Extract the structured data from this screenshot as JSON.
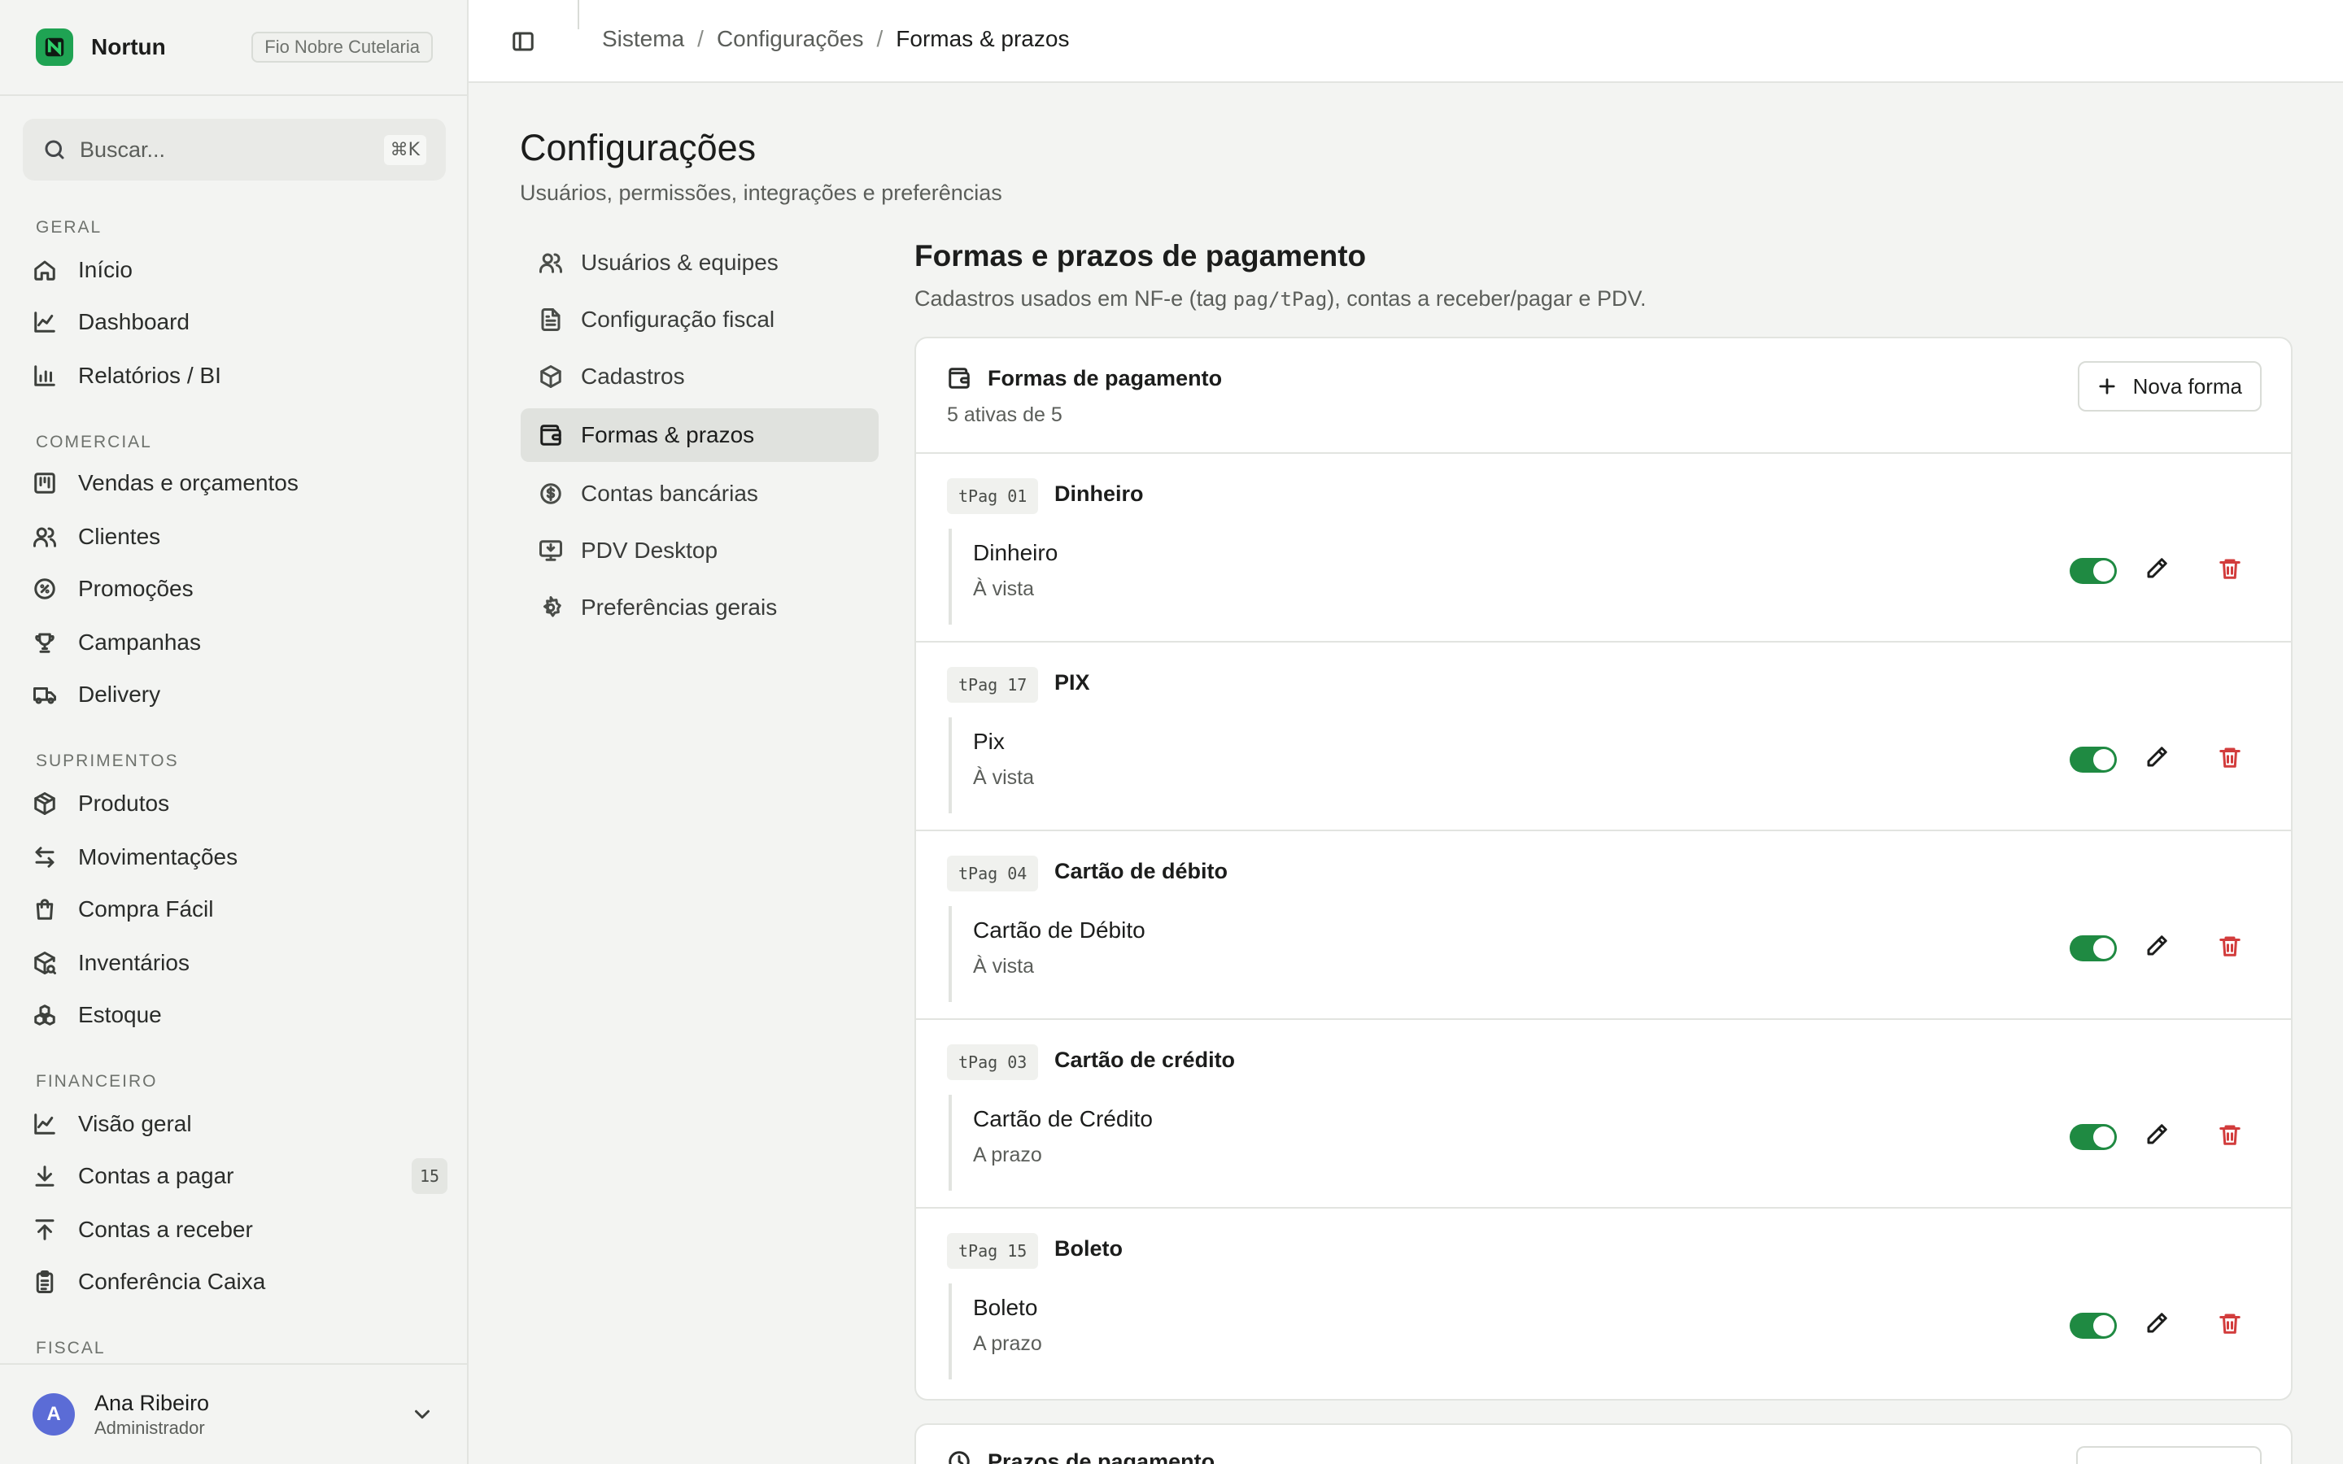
{
  "brand": {
    "name": "Nortun",
    "company": "Fio Nobre Cutelaria",
    "accent": "#1fa353"
  },
  "search": {
    "placeholder": "Buscar...",
    "shortcut": "⌘K"
  },
  "sidebar": {
    "sections": {
      "geral": "GERAL",
      "comercial": "COMERCIAL",
      "suprimentos": "SUPRIMENTOS",
      "financeiro": "FINANCEIRO",
      "fiscal": "FISCAL"
    },
    "items": {
      "inicio": "Início",
      "dashboard": "Dashboard",
      "relatorios": "Relatórios / BI",
      "vendas": "Vendas e orçamentos",
      "clientes": "Clientes",
      "promocoes": "Promoções",
      "campanhas": "Campanhas",
      "delivery": "Delivery",
      "produtos": "Produtos",
      "movimentacoes": "Movimentações",
      "compra_facil": "Compra Fácil",
      "inventarios": "Inventários",
      "estoque": "Estoque",
      "visao_geral": "Visão geral",
      "contas_pagar": "Contas a pagar",
      "contas_pagar_badge": "15",
      "contas_receber": "Contas a receber",
      "conferencia_caixa": "Conferência Caixa"
    }
  },
  "user": {
    "initial": "A",
    "name": "Ana Ribeiro",
    "role": "Administrador"
  },
  "breadcrumb": {
    "root": "Sistema",
    "parent": "Configurações",
    "current": "Formas & prazos",
    "separator": "/"
  },
  "page": {
    "title": "Configurações",
    "subtitle": "Usuários, permissões, integrações e preferências"
  },
  "settings_nav": {
    "usuarios": "Usuários & equipes",
    "fiscal": "Configuração fiscal",
    "cadastros": "Cadastros",
    "formas": "Formas & prazos",
    "contas": "Contas bancárias",
    "pdv": "PDV Desktop",
    "preferencias": "Preferências gerais"
  },
  "content": {
    "title": "Formas e prazos de pagamento",
    "desc_prefix": "Cadastros usados em NF-e (tag ",
    "desc_code": "pag/tPag",
    "desc_suffix": "), contas a receber/pagar e PDV."
  },
  "payment_card": {
    "title": "Formas de pagamento",
    "count": "5 ativas de 5",
    "new_label": "Nova forma",
    "methods": [
      {
        "code": "tPag 01",
        "group": "Dinheiro",
        "name": "Dinheiro",
        "term": "À vista",
        "active": true
      },
      {
        "code": "tPag 17",
        "group": "PIX",
        "name": "Pix",
        "term": "À vista",
        "active": true
      },
      {
        "code": "tPag 04",
        "group": "Cartão de débito",
        "name": "Cartão de Débito",
        "term": "À vista",
        "active": true
      },
      {
        "code": "tPag 03",
        "group": "Cartão de crédito",
        "name": "Cartão de Crédito",
        "term": "A prazo",
        "active": true
      },
      {
        "code": "tPag 15",
        "group": "Boleto",
        "name": "Boleto",
        "term": "A prazo",
        "active": true
      }
    ]
  },
  "terms_card": {
    "title": "Prazos de pagamento"
  },
  "colors": {
    "toggle_on": "#1f8a42",
    "danger": "#d23c3c"
  }
}
